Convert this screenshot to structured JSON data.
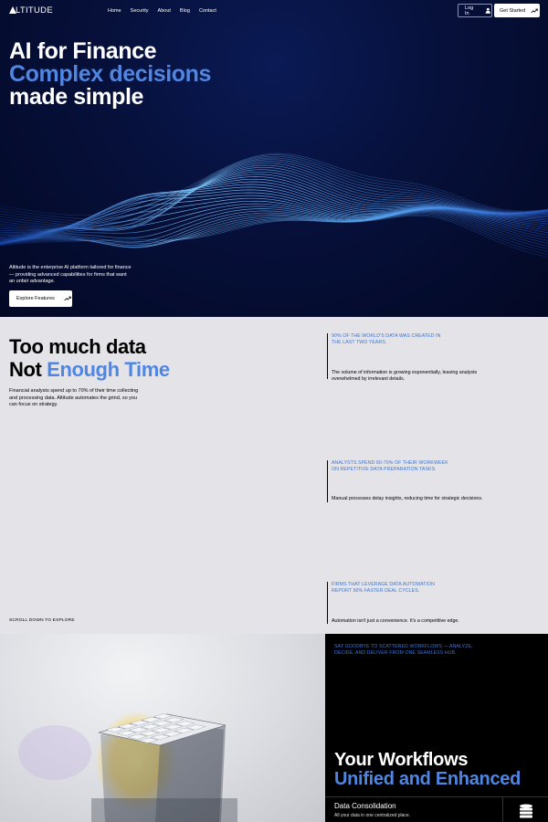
{
  "nav": {
    "logo": "LTITUDE",
    "links": [
      "Home",
      "Security",
      "About",
      "Blog",
      "Contact"
    ],
    "login_label": "Log In",
    "get_started_label": "Get Started"
  },
  "hero": {
    "title_line1": "AI for Finance",
    "title_line2": "Complex decisions",
    "title_line3": "made simple",
    "description": "Altitude is the enterprise AI platform tailored for finance — providing advanced capabilities for firms that want an unfair advantage.",
    "explore_label": "Explore Features"
  },
  "data_section": {
    "title_line1": "Too much data",
    "title_line2_a": "Not ",
    "title_line2_b": "Enough Time",
    "description": "Financial analysts spend up to 70% of their time collecting and processing data. Altitude automates the grind, so you can focus on strategy.",
    "scroll_hint": "SCROLL DOWN TO EXPLORE",
    "stats": [
      {
        "heading": "90% OF THE WORLD'S DATA WAS CREATED IN THE LAST TWO YEARS.",
        "body": "The volume of information is growing exponentially, leaving analysts overwhelmed by irrelevant details."
      },
      {
        "heading": "ANALYSTS SPEND 60-70% OF THEIR WORKWEEK ON REPETITIVE DATA PREPARATION TASKS.",
        "body": "Manual processes delay insights, reducing time for strategic decisions."
      },
      {
        "heading": "FIRMS THAT LEVERAGE DATA AUTOMATION REPORT 50% FASTER DEAL CYCLES.",
        "body": "Automation isn't just a convenience. It's a competitive edge."
      }
    ]
  },
  "workflow": {
    "heading": "SAY GOODBYE TO SCATTERED WORKFLOWS — ANALYZE, DECIDE, AND DELIVER FROM ONE SEAMLESS HUB.",
    "title_line1": "Your Workflows",
    "title_line2": "Unified and Enhanced",
    "card_title": "Data Consolidation",
    "card_desc": "All your data in one centralized place."
  },
  "colors": {
    "accent": "#4f86e2",
    "hero_bg": "#06103a",
    "section_bg": "#e4e4e8"
  }
}
